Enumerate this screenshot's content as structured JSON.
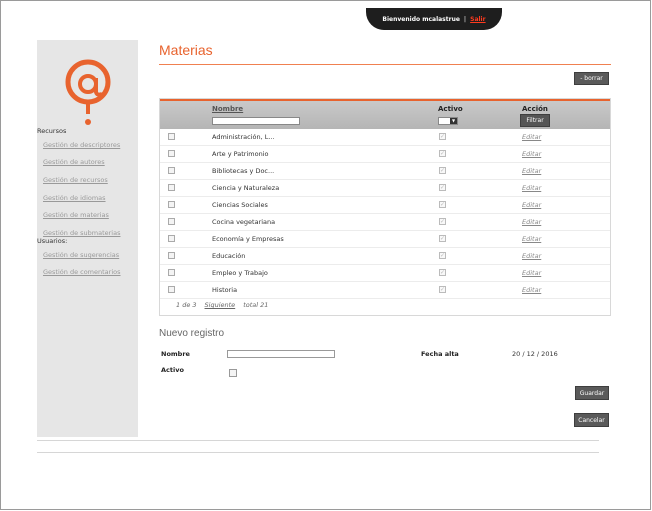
{
  "topbar": {
    "welcome": "Bienvenido mcalastrue",
    "separator": "|",
    "logout": "Salir"
  },
  "sidebar": {
    "sections": [
      {
        "label": "Recursos"
      },
      {
        "label": "Usuarios:"
      }
    ],
    "recursos_items": [
      "Gestión de descriptores",
      "Gestión de autores",
      "Gestión de recursos",
      "Gestión de idiomas",
      "Gestión de materias",
      "Gestión de submaterias"
    ],
    "usuarios_items": [
      "Gestión de sugerencias",
      "Gestión de comentarios"
    ],
    "logo_icon": "at-question-logo-icon"
  },
  "main": {
    "title": "Materias",
    "delete_button": "- borrar",
    "table": {
      "headers": {
        "nombre": "Nombre",
        "activo": "Activo",
        "accion": "Acción"
      },
      "filter_button": "Filtrar",
      "edit_label": "Editar",
      "rows": [
        "Administración, L...",
        "Arte y Patrimonio",
        "Bibliotecas y Doc...",
        "Ciencia y Naturaleza",
        "Ciencias Sociales",
        "Cocina vegetariana",
        "Economía y Empresas",
        "Educación",
        "Empleo y Trabajo",
        "Historia"
      ]
    },
    "pager": {
      "page": "1 de 3",
      "next": "Siguiente",
      "total": "total 21"
    }
  },
  "new_record": {
    "title": "Nuevo registro",
    "nombre_label": "Nombre",
    "nombre_value": "",
    "activo_label": "Activo",
    "fecha_label": "Fecha alta",
    "fecha_value": "20 / 12 / 2016",
    "save_button": "Guardar",
    "cancel_button": "Cancelar"
  },
  "colors": {
    "accent": "#e8632e",
    "sidebar_bg": "#e6e6e6",
    "button_bg": "#5a5a5a"
  }
}
